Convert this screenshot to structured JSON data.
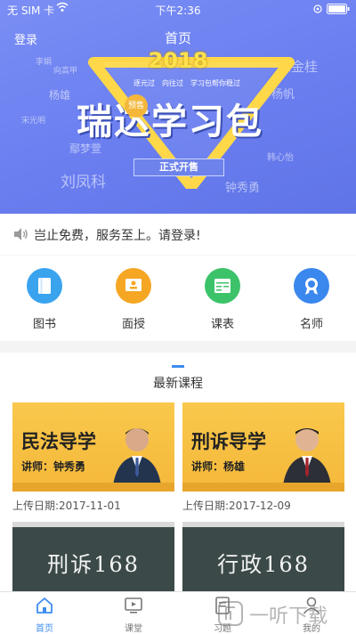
{
  "status_bar": {
    "carrier": "无 SIM 卡",
    "time": "下午2:36"
  },
  "nav": {
    "login": "登录",
    "title": "首页"
  },
  "banner": {
    "year": "2018",
    "slogan": "逐元过　向往过　学习包帮你稳过",
    "title": "瑞达学习包",
    "presale": "预售",
    "open_sale": "正式开售",
    "names": [
      "李娟",
      "杨雄",
      "宋光明",
      "刘凤科",
      "徐金桂",
      "杨帆",
      "韩心怡",
      "钟秀勇",
      "向高甲",
      "鄢梦萱"
    ]
  },
  "notice": {
    "text": "岂止免费，服务至上。请登录!"
  },
  "shortcuts": [
    {
      "label": "图书",
      "color": "#3aa3ee"
    },
    {
      "label": "面授",
      "color": "#f5a623"
    },
    {
      "label": "课表",
      "color": "#3cc36a"
    },
    {
      "label": "名师",
      "color": "#3a87ee"
    }
  ],
  "courses": {
    "section_title": "最新课程",
    "items": [
      {
        "title": "民法导学",
        "lecturer": "讲师：钟秀勇",
        "date": "上传日期:2017-11-01"
      },
      {
        "title": "刑诉导学",
        "lecturer": "讲师：杨雄",
        "date": "上传日期:2017-12-09"
      },
      {
        "title": "刑诉168"
      },
      {
        "title": "行政168"
      }
    ]
  },
  "tabbar": [
    {
      "label": "首页",
      "icon": "home-icon"
    },
    {
      "label": "课堂",
      "icon": "classroom-icon"
    },
    {
      "label": "习题",
      "icon": "exercise-icon"
    },
    {
      "label": "我的",
      "icon": "profile-icon"
    }
  ],
  "watermark": "一听下载"
}
